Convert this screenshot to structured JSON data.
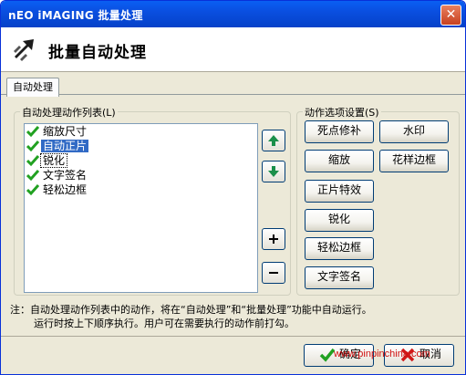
{
  "window": {
    "title": "nEO iMAGING 批量处理"
  },
  "header": {
    "title": "批量自动处理"
  },
  "tabs": [
    {
      "label": "自动处理"
    }
  ],
  "left_group": {
    "label": "自动处理动作列表(L)",
    "items": [
      {
        "label": "缩放尺寸",
        "checked": true,
        "selected": false
      },
      {
        "label": "自动正片",
        "checked": true,
        "selected": true
      },
      {
        "label": "锐化",
        "checked": true,
        "selected": false
      },
      {
        "label": "文字签名",
        "checked": true,
        "selected": false
      },
      {
        "label": "轻松边框",
        "checked": true,
        "selected": false
      }
    ]
  },
  "right_group": {
    "label": "动作选项设置(S)",
    "buttons": {
      "spot": "死点修补",
      "watermark": "水印",
      "resize": "缩放",
      "pattern_border": "花样边框",
      "positive": "正片特效",
      "sharpen": "锐化",
      "easy_border": "轻松边框",
      "text_sign": "文字签名"
    }
  },
  "note": {
    "line1": "注：自动处理动作列表中的动作，将在“自动处理”和“批量处理”功能中自动运行。",
    "line2": "运行时按上下顺序执行。用户可在需要执行的动作前打勾。"
  },
  "footer": {
    "ok": "确定",
    "cancel": "取消",
    "watermark_text": "www.pinpinchina.com"
  },
  "colors": {
    "titlebar": "#0a4fe0",
    "selection": "#316ac5",
    "check": "#21a121"
  }
}
